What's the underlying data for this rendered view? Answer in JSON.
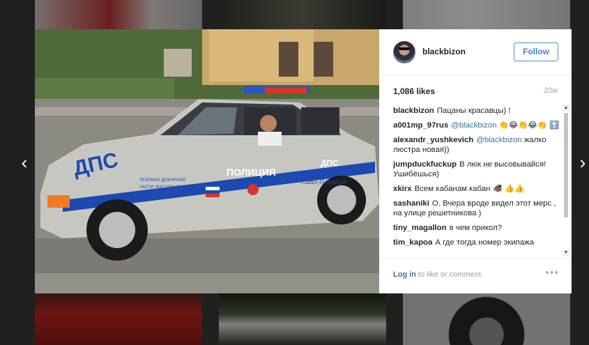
{
  "navigation": {
    "prev_arrow": "‹",
    "next_arrow": "›"
  },
  "post": {
    "username": "blackbizon",
    "follow_label": "Follow",
    "likes": "1,086 likes",
    "age": "20w",
    "photo": {
      "car_side_text": "ДПС",
      "car_door_text": "ПОЛИЦИЯ",
      "car_rear_text": "ДПС",
      "car_city_text": "Санкт-Петербург",
      "car_phone_line1": "ТЕЛЕФОН ДЕЖУРНОЙ",
      "car_phone_line2": "ЧАСТИ: 8(812)388-02-02"
    },
    "comments": [
      {
        "author": "blackbizon",
        "mention": "",
        "text": "Пацаны красавцы) !"
      },
      {
        "author": "a001mp_97rus",
        "mention": "@blackbizon",
        "text": "👏😂👏😂👏 ⬆️"
      },
      {
        "author": "alexandr_yushkevich",
        "mention": "@blackbizon",
        "text": "жалко люстра новая))"
      },
      {
        "author": "jumpduckfuckup",
        "mention": "",
        "text": "В люк не высовывайся! Ушибёшься)"
      },
      {
        "author": "xkirx",
        "mention": "",
        "text": "Всем кабанам кабан 🐗 👍👍"
      },
      {
        "author": "sashaniki",
        "mention": "",
        "text": "О. Вчера вроде видел этот мерс , на улице решетникова )"
      },
      {
        "author": "tiny_magallon",
        "mention": "",
        "text": "в чем прикол?"
      },
      {
        "author": "tim_kapoa",
        "mention": "",
        "text": "А где тогда номер экипажа"
      }
    ],
    "footer": {
      "login_link": "Log in",
      "login_suffix": " to like or comment.",
      "more_label": "•••"
    },
    "scroll": {
      "up": "▲",
      "down": "▼"
    }
  },
  "colors": {
    "accent": "#3f86d3",
    "link": "#3f729b",
    "muted": "#a0a0a0"
  }
}
